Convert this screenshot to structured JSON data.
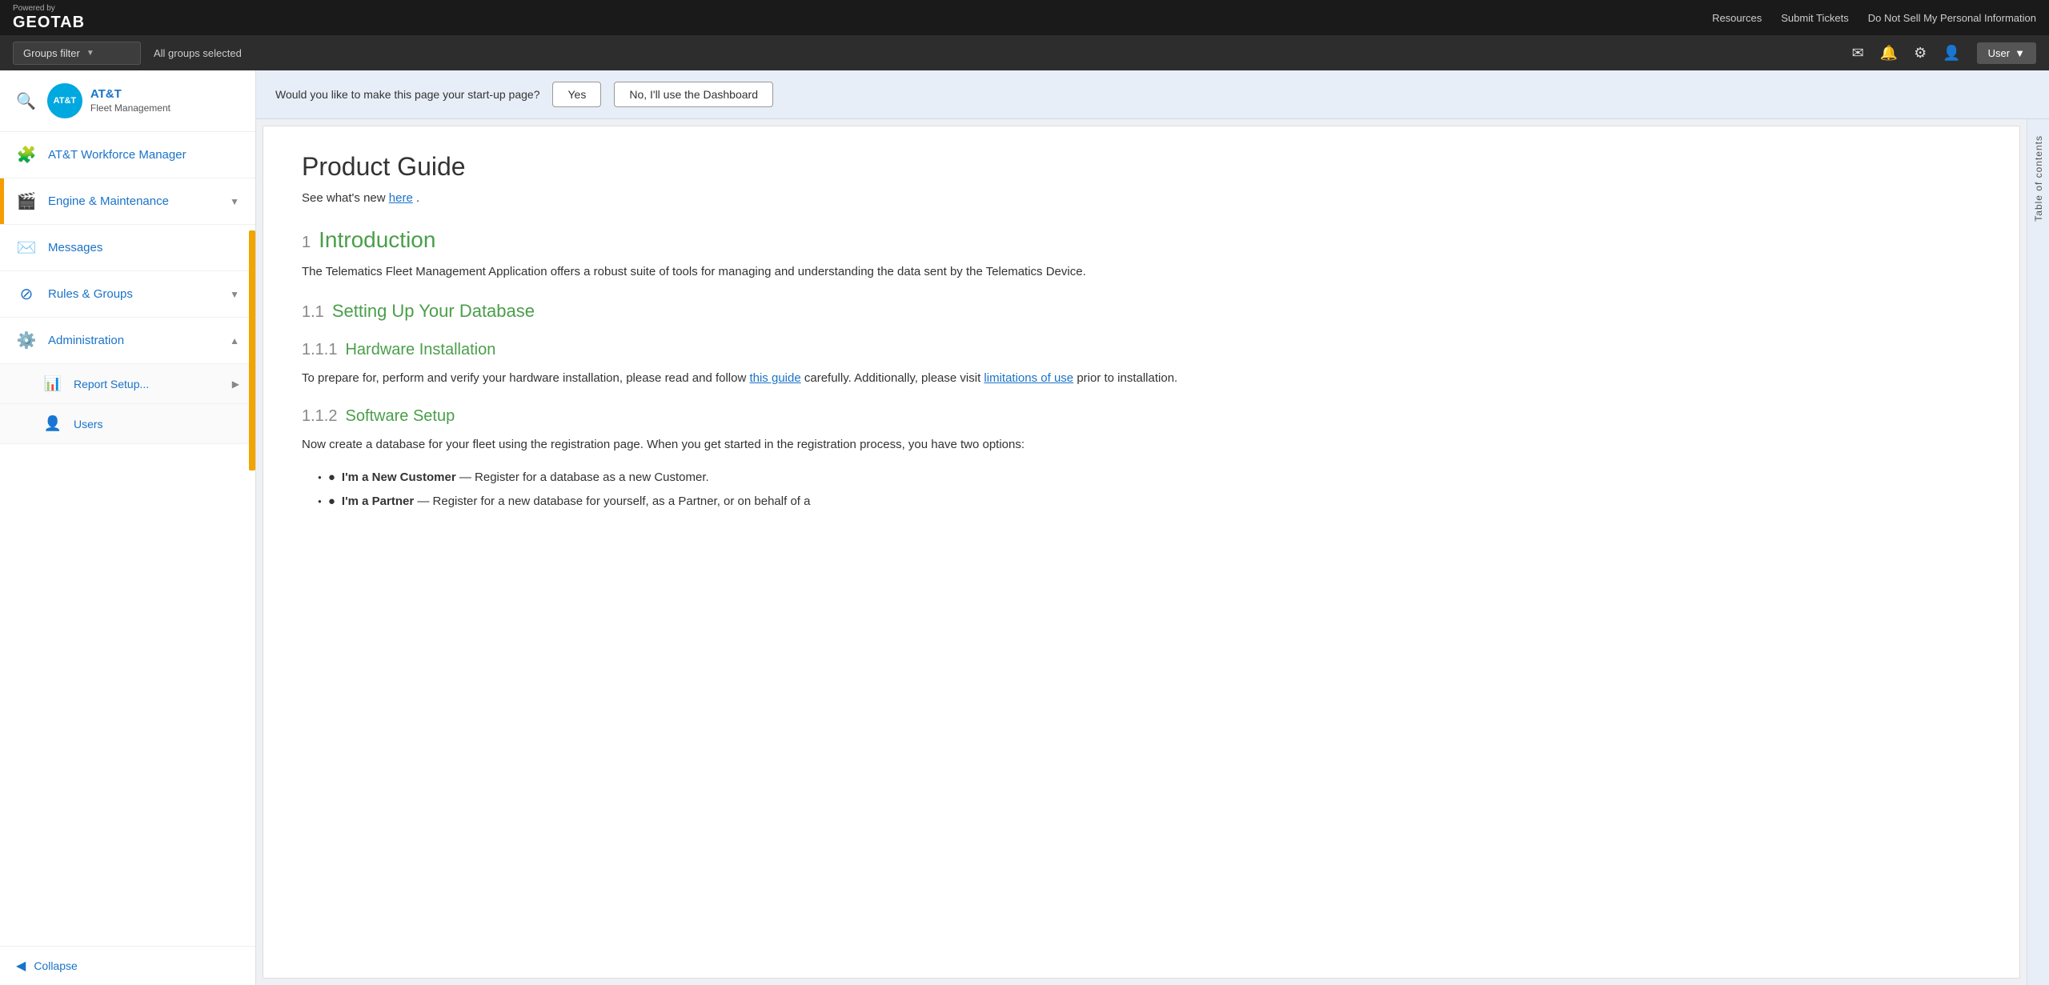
{
  "topBar": {
    "poweredBy": "Powered by",
    "logoText": "GEOTAB",
    "links": {
      "resources": "Resources",
      "submitTickets": "Submit Tickets",
      "doNotSell": "Do Not Sell My Personal Information"
    }
  },
  "filterBar": {
    "groupsFilterLabel": "Groups filter",
    "groupsSelectedText": "All groups selected"
  },
  "sidebar": {
    "search": {
      "placeholder": "Search"
    },
    "company": {
      "name": "AT&T",
      "subName": "Fleet Management",
      "logoText": "AT&T"
    },
    "navItems": [
      {
        "id": "workforce",
        "label": "AT&T Workforce Manager",
        "icon": "🧩",
        "hasChildren": false
      },
      {
        "id": "engine",
        "label": "Engine & Maintenance",
        "icon": "🎬",
        "hasChildren": true
      },
      {
        "id": "messages",
        "label": "Messages",
        "icon": "✉️",
        "hasChildren": false
      },
      {
        "id": "rules",
        "label": "Rules & Groups",
        "icon": "⊘",
        "hasChildren": true
      },
      {
        "id": "admin",
        "label": "Administration",
        "icon": "⚙️",
        "hasChildren": true,
        "isOpen": true
      }
    ],
    "subItems": [
      {
        "id": "reportsetup",
        "label": "Report Setup...",
        "icon": "📊",
        "hasArrow": true
      },
      {
        "id": "users",
        "label": "Users",
        "icon": "👤",
        "hasArrow": false
      }
    ],
    "collapse": "Collapse"
  },
  "content": {
    "banner": {
      "question": "Would you like to make this page your start-up page?",
      "yesLabel": "Yes",
      "noLabel": "No, I'll use the Dashboard"
    },
    "guide": {
      "title": "Product Guide",
      "intro": "See what's new ",
      "introLink": "here",
      "introDot": ".",
      "toc": "Table of contents",
      "sections": [
        {
          "num": "1",
          "title": "Introduction",
          "body": "The Telematics Fleet Management Application offers a robust suite of tools for managing and understanding the data sent by the Telematics Device."
        },
        {
          "num": "1.1",
          "title": "Setting Up Your Database",
          "body": ""
        },
        {
          "num": "1.1.1",
          "title": "Hardware Installation",
          "body": "To prepare for, perform and verify your hardware installation, please read and follow ",
          "bodyLink1": "this guide",
          "bodyMid": " carefully. Additionally, please visit ",
          "bodyLink2": "limitations of use",
          "bodyEnd": " prior to installation."
        },
        {
          "num": "1.1.2",
          "title": "Software Setup",
          "body": "Now create a database for your fleet using the registration page. When you get started in the registration process, you have two options:"
        }
      ],
      "bullets": [
        {
          "bold": "I'm a New Customer",
          "text": " — Register for a database as a new Customer."
        },
        {
          "bold": "I'm a Partner",
          "text": " — Register for a new database for yourself, as a Partner, or on behalf of a"
        }
      ]
    }
  }
}
